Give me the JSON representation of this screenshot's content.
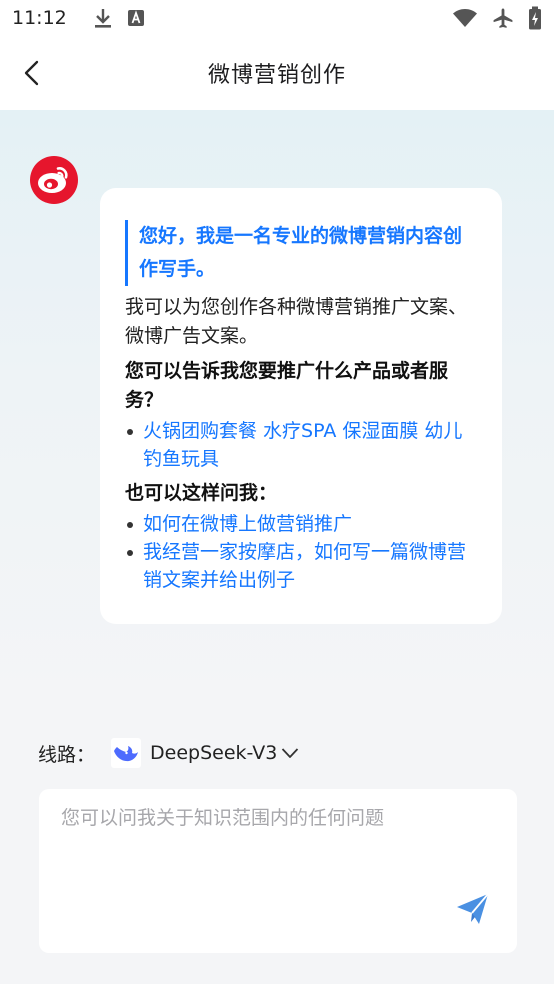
{
  "status_bar": {
    "time": "11:12",
    "left_icons": [
      "download-icon",
      "keyboard-a-icon"
    ],
    "right_icons": [
      "wifi-icon",
      "airplane-mode-icon",
      "battery-charging-icon"
    ]
  },
  "header": {
    "title": "微博营销创作"
  },
  "bot": {
    "avatar_icon": "weibo-logo-icon",
    "intro": "您好，我是一名专业的微博营销内容创作写手。",
    "description": "我可以为您创作各种微博营销推广文案、微博广告文案。",
    "prompt_products": "您可以告诉我您要推广什么产品或者服务？",
    "product_examples": [
      "火锅团购套餐 水疗SPA 保湿面膜 幼儿钓鱼玩具"
    ],
    "prompt_questions": "也可以这样问我：",
    "question_examples": [
      "如何在微博上做营销推广",
      "我经营一家按摩店，如何写一篇微博营销文案并给出例子"
    ]
  },
  "route": {
    "label": "线路：",
    "model_icon": "deepseek-whale-icon",
    "model_name": "DeepSeek-V3"
  },
  "input": {
    "placeholder": "您可以问我关于知识范围内的任何问题",
    "value": ""
  },
  "colors": {
    "accent": "#1677ff",
    "weibo_red": "#e6162d",
    "deepseek_blue": "#4d6bfe",
    "send_blue": "#4a90e2"
  }
}
